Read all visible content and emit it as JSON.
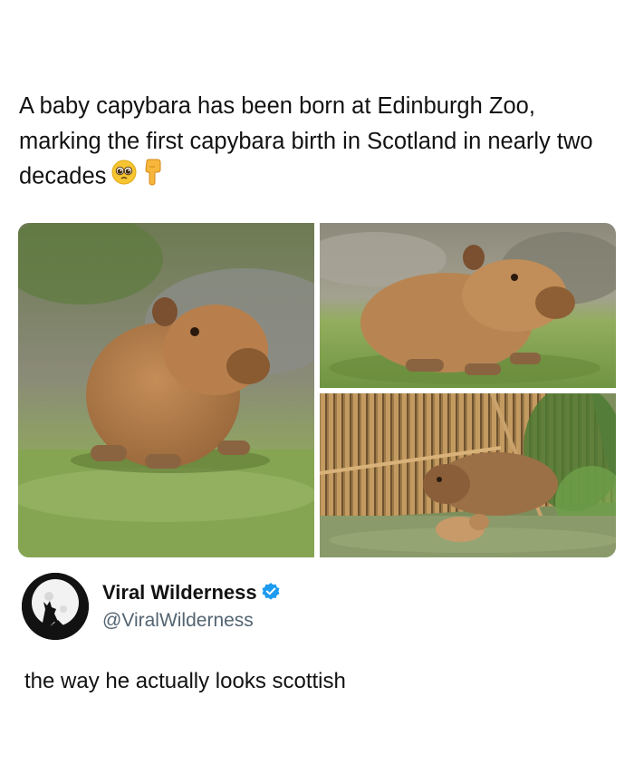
{
  "post": {
    "headline": "A baby capybara has been born at Edinburgh Zoo, marking the first capybara birth in Scotland in nearly two decades",
    "emojis": [
      "pleading-face-icon",
      "backhand-index-pointing-down-icon"
    ]
  },
  "photos": [
    {
      "subject": "baby capybara sitting on grass"
    },
    {
      "subject": "baby capybara lying on grass"
    },
    {
      "subject": "adult and baby capybara under bamboo shelter"
    }
  ],
  "author": {
    "display_name": "Viral Wilderness",
    "handle": "@ViralWilderness",
    "verified": true,
    "verified_color": "#1d9bf0"
  },
  "tweet": {
    "text": "the way he actually looks scottish"
  }
}
